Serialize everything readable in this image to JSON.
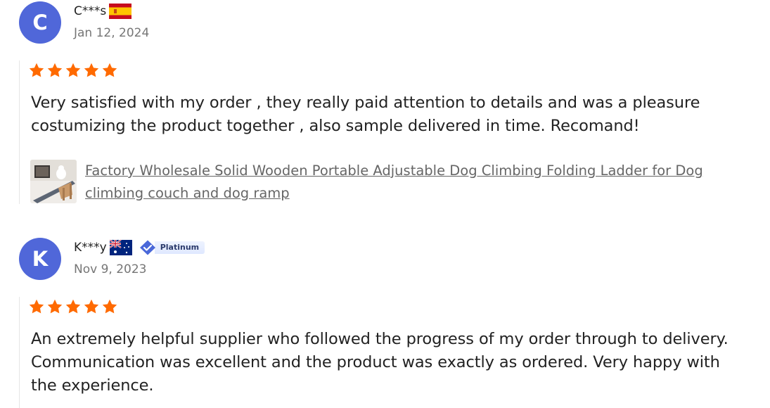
{
  "reviews": [
    {
      "avatar_letter": "C",
      "name": "C***s",
      "flag_icon": "spain-flag-icon",
      "date": "Jan 12, 2024",
      "rating": 5,
      "text": "Very satisfied with my order , they really paid attention to details and was a pleasure costumizing the product together , also sample delivered in time. Recomand!",
      "product_title": "Factory Wholesale Solid Wooden Portable Adjustable Dog Climbing Folding Ladder for Dog climbing couch and dog ramp"
    },
    {
      "avatar_letter": "K",
      "name": "K***y",
      "flag_icon": "australia-flag-icon",
      "badge": "Platinum",
      "date": "Nov 9, 2023",
      "rating": 5,
      "text": "An extremely helpful supplier who followed the progress of my order through to delivery. Communication was excellent and the product was exactly as ordered. Very happy with the experience."
    }
  ],
  "colors": {
    "avatar": "#5067d9",
    "star": "#ff6a00",
    "link": "#666666",
    "date": "#767676"
  }
}
